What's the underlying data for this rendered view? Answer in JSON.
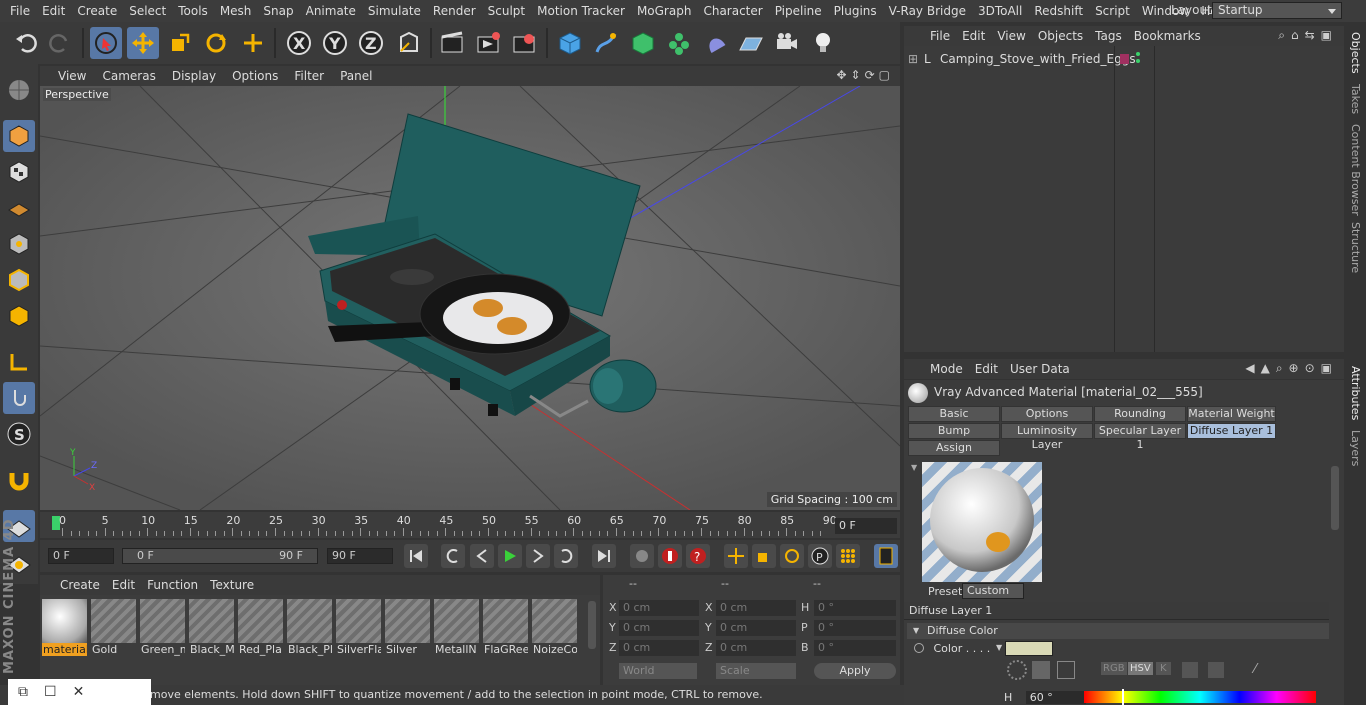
{
  "menubar": {
    "items": [
      "File",
      "Edit",
      "Create",
      "Select",
      "Tools",
      "Mesh",
      "Snap",
      "Animate",
      "Simulate",
      "Render",
      "Sculpt",
      "Motion Tracker",
      "MoGraph",
      "Character",
      "Pipeline",
      "Plugins",
      "V-Ray Bridge",
      "3DToAll",
      "Redshift",
      "Script",
      "Window",
      "Help"
    ]
  },
  "layout": {
    "label": "Layout:",
    "value": "Startup"
  },
  "viewport": {
    "menu": [
      "View",
      "Cameras",
      "Display",
      "Options",
      "Filter",
      "Panel"
    ],
    "label": "Perspective",
    "grid_spacing": "Grid Spacing : 100 cm",
    "axis": {
      "y": "Y",
      "z": "Z",
      "x": "X"
    }
  },
  "timeline": {
    "ticks": [
      "0",
      "5",
      "10",
      "15",
      "20",
      "25",
      "30",
      "35",
      "40",
      "45",
      "50",
      "55",
      "60",
      "65",
      "70",
      "75",
      "80",
      "85",
      "90"
    ],
    "current_frame": "0 F"
  },
  "playback": {
    "start": "0 F",
    "range_start": "0 F",
    "range_end": "90 F",
    "end": "90 F"
  },
  "materials": {
    "menu": [
      "Create",
      "Edit",
      "Function",
      "Texture"
    ],
    "items": [
      "material",
      "Gold",
      "Green_m",
      "Black_M",
      "Red_Pla",
      "Black_Pl",
      "SilverFla",
      "Silver",
      "MetallN",
      "FlaGRee",
      "NoizeCo"
    ]
  },
  "coordinates": {
    "headers": [
      "--",
      "--",
      "--"
    ],
    "rows": [
      {
        "a": "X",
        "av": "0 cm",
        "b": "X",
        "bv": "0 cm",
        "c": "H",
        "cv": "0 °"
      },
      {
        "a": "Y",
        "av": "0 cm",
        "b": "Y",
        "bv": "0 cm",
        "c": "P",
        "cv": "0 °"
      },
      {
        "a": "Z",
        "av": "0 cm",
        "b": "Z",
        "bv": "0 cm",
        "c": "B",
        "cv": "0 °"
      }
    ],
    "world": "World",
    "scale": "Scale",
    "apply": "Apply"
  },
  "status": "move elements. Hold down SHIFT to quantize movement / add to the selection in point mode, CTRL to remove.",
  "brand": "MAXON CINEMA 4D",
  "objects": {
    "menu": [
      "File",
      "Edit",
      "View",
      "Objects",
      "Tags",
      "Bookmarks"
    ],
    "root": "Camping_Stove_with_Fried_Eggs"
  },
  "right_tabs": [
    "Objects",
    "Takes",
    "Content Browser",
    "Structure",
    "Attributes",
    "Layers"
  ],
  "attributes": {
    "menu": [
      "Mode",
      "Edit",
      "User Data"
    ],
    "title": "Vray Advanced Material [material_02___555]",
    "tabs_row1": [
      "Basic",
      "Options",
      "Rounding",
      "Material Weight"
    ],
    "tabs_row2": [
      "Bump",
      "Luminosity Layer",
      "Specular Layer 1",
      "Diffuse Layer 1"
    ],
    "tabs_row3": [
      "Assign"
    ],
    "preset_label": "Preset",
    "preset_value": "Custom",
    "section_title": "Diffuse Layer 1",
    "group_title": "Diffuse Color",
    "color_label": "Color . . . .",
    "color_modes": [
      "RGB",
      "HSV",
      "K"
    ],
    "h_label": "H",
    "h_value": "60 °",
    "swatch_color": "#d9d9b6"
  }
}
